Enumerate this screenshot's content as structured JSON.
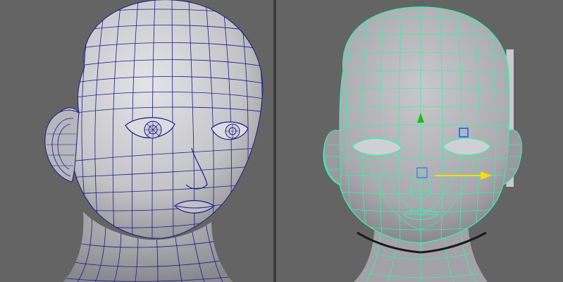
{
  "viewports": [
    {
      "id": "left",
      "mode": "shaded-wireframe",
      "wire_color": "#1c1a8a",
      "surface_color": "#c8c8cc"
    },
    {
      "id": "right",
      "mode": "selected-wireframe",
      "wire_color": "#3ef0a8",
      "surface_color": "#b4b4b8"
    }
  ],
  "manipulator": {
    "x_axis_color": "#f5e000",
    "y_axis_color": "#18c018",
    "selection_color": "#3a6cff"
  }
}
